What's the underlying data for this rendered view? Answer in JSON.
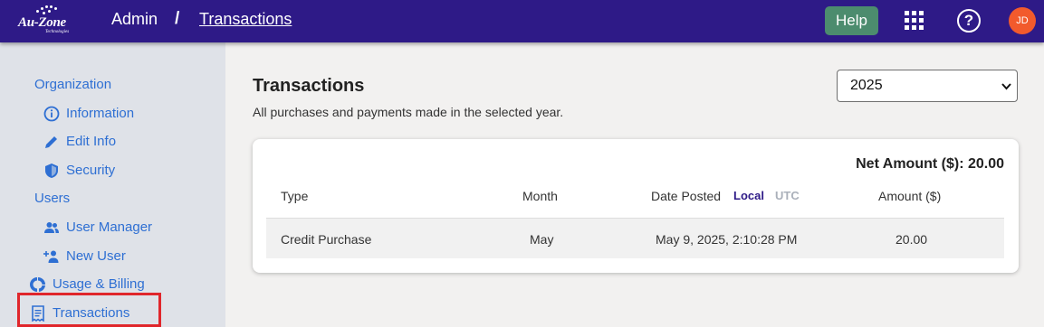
{
  "header": {
    "logo_text": "Au-Zone",
    "logo_sub": "Technologies",
    "breadcrumb_root": "Admin",
    "breadcrumb_sep": "/",
    "breadcrumb_current": "Transactions",
    "help_label": "Help",
    "help_icon_glyph": "?",
    "avatar_initials": "JD",
    "icons": [
      "apps-grid-icon",
      "help-circle-icon"
    ],
    "colors": {
      "bar": "#2e1a87",
      "help": "#4c8c6e",
      "avatar": "#f25a2c"
    }
  },
  "sidebar": {
    "org_label": "Organization",
    "org_items": [
      {
        "label": "Information",
        "icon": "info-icon"
      },
      {
        "label": "Edit Info",
        "icon": "pencil-icon"
      },
      {
        "label": "Security",
        "icon": "shield-icon"
      }
    ],
    "users_label": "Users",
    "user_items": [
      {
        "label": "User Manager",
        "icon": "users-icon"
      },
      {
        "label": "New User",
        "icon": "person-add-icon"
      }
    ],
    "usage_label": "Usage & Billing",
    "transactions_label": "Transactions",
    "link_color": "#2e6fd3",
    "highlight_color": "#e0262b"
  },
  "main": {
    "title": "Transactions",
    "description": "All purchases and payments made in the selected year.",
    "year_selected": "2025",
    "net_amount": "Net Amount ($): 20.00",
    "columns": {
      "type": "Type",
      "month": "Month",
      "date_posted": "Date Posted",
      "tz_local": "Local",
      "tz_utc": "UTC",
      "amount": "Amount ($)"
    },
    "rows": [
      {
        "type": "Credit Purchase",
        "month": "May",
        "date_posted": "May 9, 2025, 2:10:28 PM",
        "amount": "20.00"
      }
    ]
  }
}
